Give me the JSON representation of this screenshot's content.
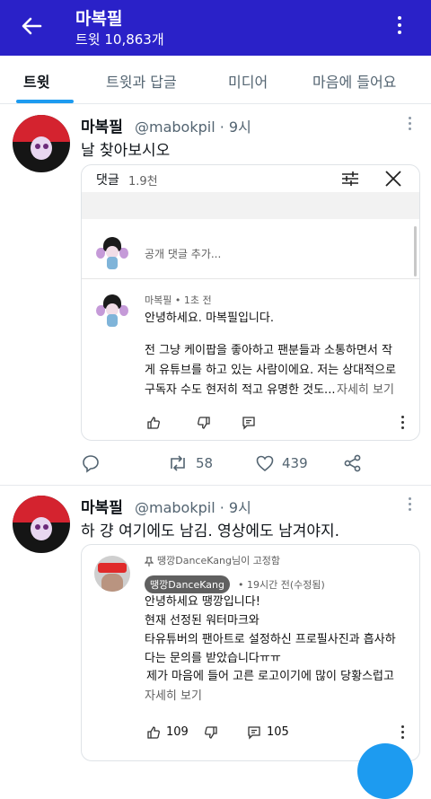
{
  "header": {
    "title": "마복필",
    "subtitle": "트윗 10,863개"
  },
  "tabs": [
    {
      "label": "트윗"
    },
    {
      "label": "트윗과 답글"
    },
    {
      "label": "미디어"
    },
    {
      "label": "마음에 들어요"
    }
  ],
  "tweets": [
    {
      "name": "마복필",
      "handle": "@mabokpil · 9시",
      "text": "날 찾아보시오",
      "card": {
        "comments_label": "댓글",
        "comments_count": "1.9천",
        "add_comment_placeholder": "공개 댓글 추가...",
        "comment": {
          "author": "마복필 • 1초 전",
          "line1": "안녕하세요. 마복필입니다.",
          "line2": "전 그냥 케이팝을 좋아하고 팬분들과 소통하면서 작",
          "line3": "게 유튜브를 하고 있는 사람이에요. 저는 상대적으로",
          "line4": "구독자 수도 현저히 적고 유명한 것도...",
          "more": "자세히 보기"
        }
      },
      "actions": {
        "replies": "",
        "retweets": "58",
        "likes": "439"
      }
    },
    {
      "name": "마복필",
      "handle": "@mabokpil · 9시",
      "text": "하 걍 여기에도 남김. 영상에도 남겨야지.",
      "card": {
        "pinned": "땡깡DanceKang님이 고정함",
        "author_badge": "땡깡DanceKang",
        "meta": "• 19시간 전(수정됨)",
        "line1": "안녕하세요 땡깡입니다!",
        "line2": "현재 선정된 워터마크와",
        "line3": "타유튜버의 팬아트로 설정하신 프로필사진과 흡사하",
        "line4": "다는 문의를 받았습니다ㅠㅠ",
        "line5": "제가 마음에 들어 고른 로고이기에 많이 당황스럽고",
        "more": "자세히 보기",
        "likes": "109",
        "replies": "105"
      }
    }
  ],
  "colors": {
    "header_bg": "#2a21c8",
    "accent": "#1d9bf0"
  }
}
